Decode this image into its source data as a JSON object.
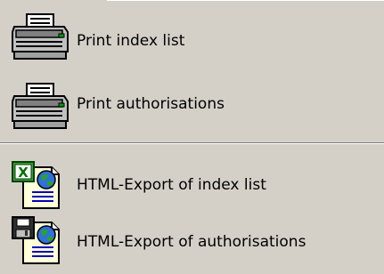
{
  "menu": {
    "items": [
      {
        "label": "Print index list",
        "icon": "printer-icon"
      },
      {
        "label": "Print authorisations",
        "icon": "printer-icon"
      },
      {
        "label": "HTML-Export of index list",
        "icon": "excel-html-export-icon"
      },
      {
        "label": "HTML-Export of authorisations",
        "icon": "floppy-html-export-icon"
      }
    ]
  },
  "colors": {
    "menu_background": "#d4d0c8",
    "separator_dark": "#808080",
    "separator_light": "#ffffff"
  }
}
